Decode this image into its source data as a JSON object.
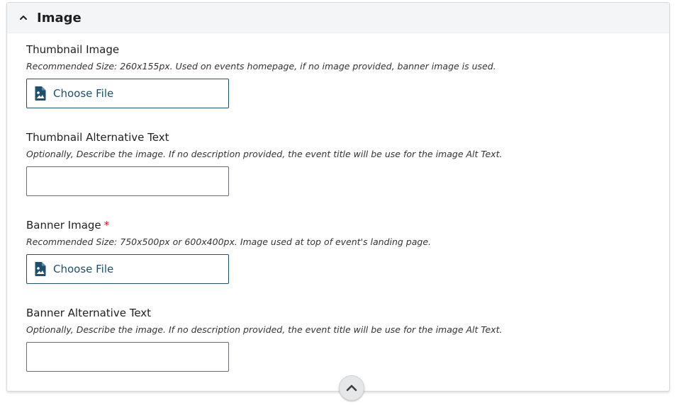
{
  "section": {
    "title": "Image",
    "collapse_icon": "chevron-up-icon"
  },
  "fields": {
    "thumbnail_image": {
      "label": "Thumbnail Image",
      "description": "Recommended Size: 260x155px. Used on events homepage, if no image provided, banner image is used.",
      "button_label": "Choose File",
      "icon": "file-image-icon"
    },
    "thumbnail_alt": {
      "label": "Thumbnail Alternative Text",
      "description": "Optionally, Describe the image. If no description provided, the event title will be use for the image Alt Text.",
      "value": ""
    },
    "banner_image": {
      "label": "Banner Image",
      "required_marker": "*",
      "description": "Recommended Size: 750x500px or 600x400px. Image used at top of event's landing page.",
      "button_label": "Choose File",
      "icon": "file-image-icon"
    },
    "banner_alt": {
      "label": "Banner Alternative Text",
      "description": "Optionally, Describe the image. If no description provided, the event title will be use for the image Alt Text.",
      "value": ""
    }
  },
  "scroll_top": {
    "icon": "chevron-up-icon"
  },
  "colors": {
    "accent": "#1d4f6e",
    "required": "#cc1f1f",
    "header_bg": "#f4f5f7"
  }
}
